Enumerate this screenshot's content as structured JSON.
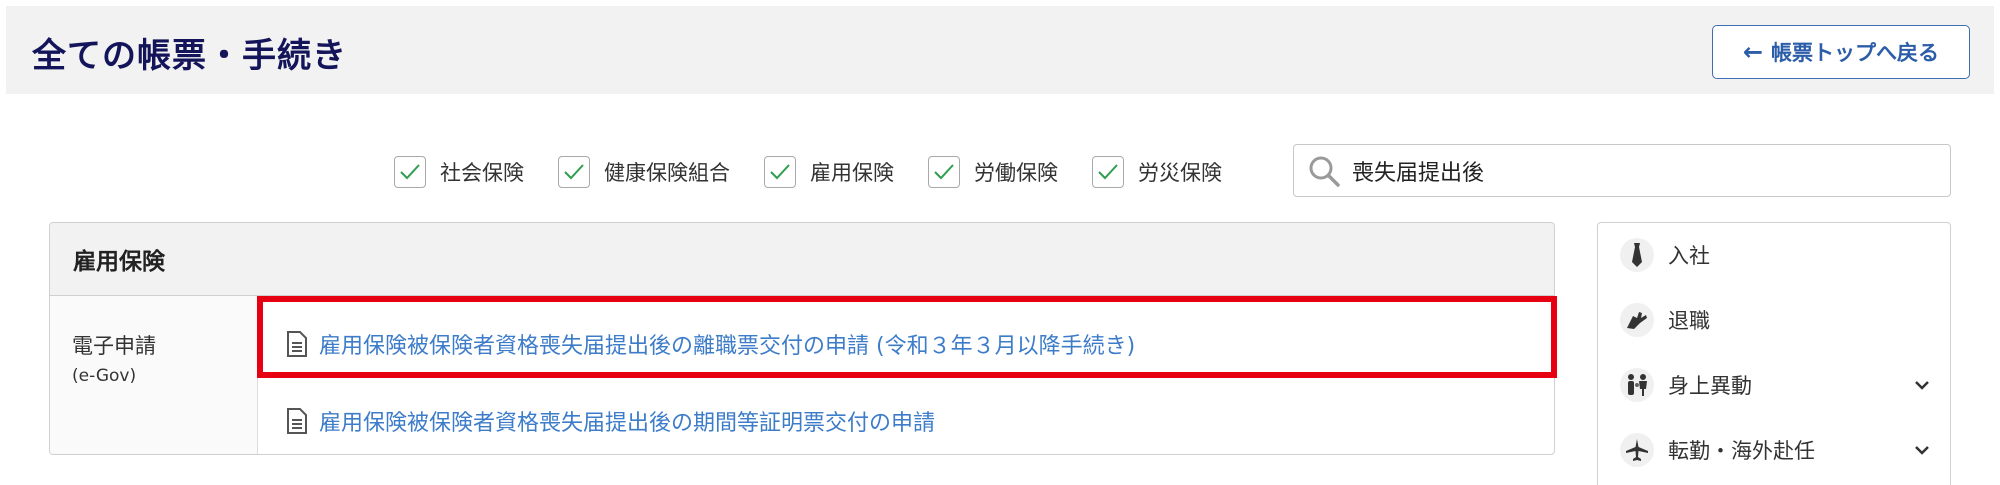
{
  "header": {
    "title": "全ての帳票・手続き",
    "back_label": "帳票トップへ戻る"
  },
  "filters": [
    {
      "label": "社会保険",
      "checked": true
    },
    {
      "label": "健康保険組合",
      "checked": true
    },
    {
      "label": "雇用保険",
      "checked": true
    },
    {
      "label": "労働保険",
      "checked": true
    },
    {
      "label": "労災保険",
      "checked": true
    }
  ],
  "search": {
    "value": "喪失届提出後"
  },
  "panel": {
    "title": "雇用保険",
    "category_title": "電子申請",
    "category_sub": "(e-Gov)",
    "links": [
      {
        "text": "雇用保険被保険者資格喪失届提出後の離職票交付の申請 (令和３年３月以降手続き)",
        "highlighted": true
      },
      {
        "text": "雇用保険被保険者資格喪失届提出後の期間等証明票交付の申請",
        "highlighted": false
      }
    ]
  },
  "sidebar": {
    "items": [
      {
        "label": "入社",
        "icon": "necktie-icon",
        "expandable": false
      },
      {
        "label": "退職",
        "icon": "wave-hand-icon",
        "expandable": false
      },
      {
        "label": "身上異動",
        "icon": "family-icon",
        "expandable": true
      },
      {
        "label": "転勤・海外赴任",
        "icon": "airplane-icon",
        "expandable": true
      }
    ]
  },
  "colors": {
    "title": "#14145a",
    "link": "#3d7cc9",
    "check": "#2e9e4f",
    "highlight": "#e60012",
    "header_bg": "#f2f2f2"
  }
}
